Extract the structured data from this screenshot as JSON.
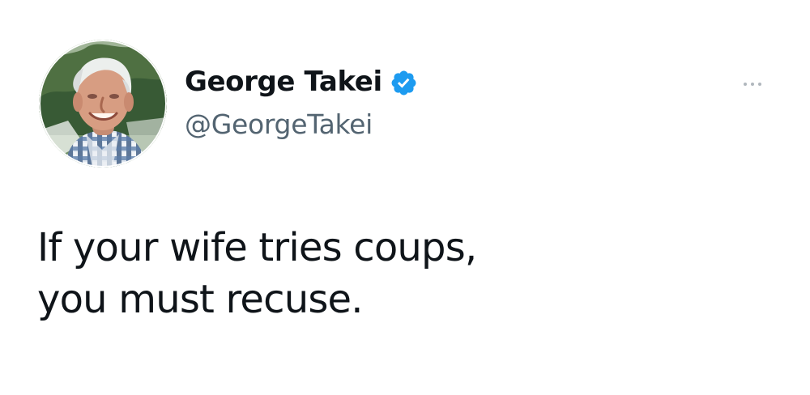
{
  "tweet": {
    "author": {
      "display_name": "George Takei",
      "handle": "@GeorgeTakei",
      "verified": true,
      "avatar_icon": "profile-photo-icon",
      "verified_icon": "verified-badge-icon"
    },
    "more_icon": "more-options-icon",
    "text_lines": [
      "If your wife tries coups,",
      "you must recuse."
    ],
    "colors": {
      "verified_blue": "#1d9bf0",
      "handle_gray": "#536471",
      "text_black": "#0f1419",
      "more_gray": "#b0b7bd"
    }
  }
}
